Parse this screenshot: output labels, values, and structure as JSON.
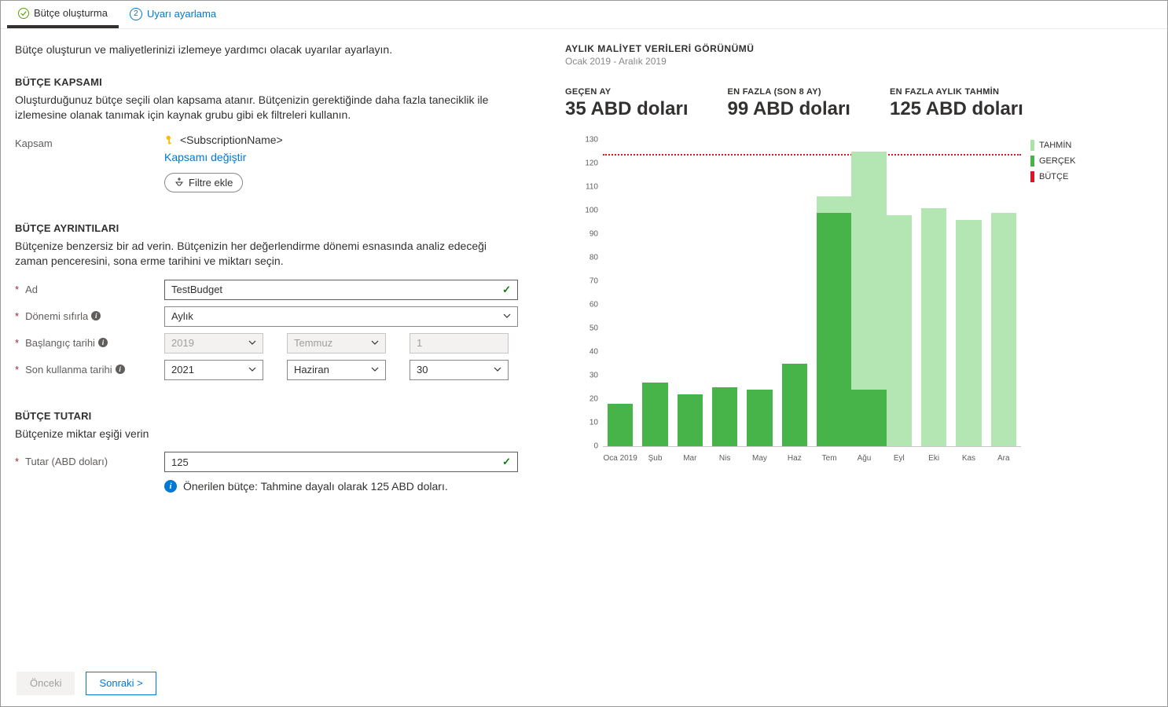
{
  "tabs": {
    "step1": "Bütçe oluşturma",
    "step2": "Uyarı ayarlama",
    "step2_num": "2"
  },
  "intro": "Bütçe oluşturun ve maliyetlerinizi izlemeye yardımcı olacak uyarılar ayarlayın.",
  "scope": {
    "title": "BÜTÇE KAPSAMI",
    "desc": "Oluşturduğunuz bütçe seçili olan kapsama atanır. Bütçenizin gerektiğinde daha fazla taneciklik ile izlemesine olanak tanımak için kaynak grubu gibi ek filtreleri kullanın.",
    "label": "Kapsam",
    "value": "<SubscriptionName>",
    "change_link": "Kapsamı değiştir",
    "filter_btn": "Filtre ekle"
  },
  "details": {
    "title": "BÜTÇE AYRINTILARI",
    "desc": "Bütçenize benzersiz bir ad verin. Bütçenizin her değerlendirme dönemi esnasında analiz edeceği zaman penceresini, sona erme tarihini ve miktarı seçin.",
    "name_label": "Ad",
    "name_value": "TestBudget",
    "reset_label": "Dönemi sıfırla",
    "reset_value": "Aylık",
    "start_label": "Başlangıç tarihi",
    "start_year": "2019",
    "start_month": "Temmuz",
    "start_day": "1",
    "end_label": "Son kullanma tarihi",
    "end_year": "2021",
    "end_month": "Haziran",
    "end_day": "30"
  },
  "amount": {
    "title": "BÜTÇE TUTARI",
    "desc": "Bütçenize miktar eşiği verin",
    "label": "Tutar (ABD doları)",
    "value": "125",
    "suggest": "Önerilen bütçe: Tahmine dayalı olarak 125 ABD doları."
  },
  "footer": {
    "prev": "Önceki",
    "next": "Sonraki  >"
  },
  "right": {
    "title": "AYLIK MALİYET VERİLERİ GÖRÜNÜMÜ",
    "subtitle": "Ocak 2019 - Aralık 2019",
    "stat1_lbl": "GEÇEN AY",
    "stat1_val": "35 ABD doları",
    "stat2_lbl": "EN FAZLA (SON 8 AY)",
    "stat2_val": "99 ABD doları",
    "stat3_lbl": "EN FAZLA AYLIK TAHMİN",
    "stat3_val": "125 ABD doları",
    "legend_forecast": "TAHMİN",
    "legend_actual": "GERÇEK",
    "legend_budget": "BÜTÇE"
  },
  "chart_data": {
    "type": "bar",
    "categories": [
      "Oca 2019",
      "Şub",
      "Mar",
      "Nis",
      "May",
      "Haz",
      "Tem",
      "Ağu",
      "Eyl",
      "Eki",
      "Kas",
      "Ara"
    ],
    "series": [
      {
        "name": "Gerçek",
        "values": [
          18,
          27,
          22,
          25,
          24,
          35,
          99,
          24,
          null,
          null,
          null,
          null
        ]
      },
      {
        "name": "Tahmin",
        "values": [
          null,
          null,
          null,
          null,
          null,
          null,
          106,
          125,
          98,
          101,
          96,
          99
        ]
      }
    ],
    "budget_line": 124,
    "ylim": [
      0,
      130
    ],
    "y_ticks": [
      0,
      10,
      20,
      30,
      40,
      50,
      60,
      70,
      80,
      90,
      100,
      110,
      120,
      130
    ],
    "title": "AYLIK MALİYET VERİLERİ GÖRÜNÜMÜ",
    "xlabel": "",
    "ylabel": ""
  }
}
